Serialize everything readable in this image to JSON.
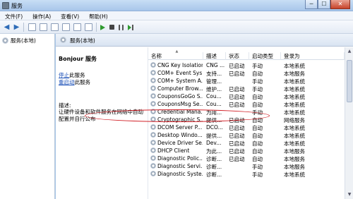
{
  "window": {
    "title": "服务",
    "min": "─",
    "max": "☐",
    "close": "✕"
  },
  "menu": [
    "文件(F)",
    "操作(A)",
    "查看(V)",
    "帮助(H)"
  ],
  "tree": {
    "root_label": "服务(本地)"
  },
  "pane": {
    "header_label": "服务(本地)",
    "service_name": "Bonjour 服务",
    "stop_link": "停止",
    "stop_suffix": "此服务",
    "restart_link": "重启动",
    "restart_suffix": "此服务",
    "desc_label": "描述:",
    "desc_text": "让硬件设备和软件服务在网络中自动配置并自行公布"
  },
  "columns": {
    "name": "名称",
    "desc": "描述",
    "status": "状态",
    "startup": "启动类型",
    "logon": "登录为"
  },
  "services": [
    {
      "name": "CNG Key Isolation",
      "desc": "CNG ...",
      "status": "已启动",
      "startup": "手动",
      "logon": "本地系统"
    },
    {
      "name": "COM+ Event Sys...",
      "desc": "支持...",
      "status": "已启动",
      "startup": "自动",
      "logon": "本地服务"
    },
    {
      "name": "COM+ System A...",
      "desc": "管理...",
      "status": "",
      "startup": "手动",
      "logon": "本地系统"
    },
    {
      "name": "Computer Brow...",
      "desc": "维护...",
      "status": "已启动",
      "startup": "手动",
      "logon": "本地系统"
    },
    {
      "name": "CouponsGoGo S...",
      "desc": "Cou...",
      "status": "已启动",
      "startup": "自动",
      "logon": "本地系统"
    },
    {
      "name": "CouponsMsg Se...",
      "desc": "Cou...",
      "status": "已启动",
      "startup": "自动",
      "logon": "本地系统"
    },
    {
      "name": "Credential Mana...",
      "desc": "为用...",
      "status": "",
      "startup": "手动",
      "logon": "本地系统"
    },
    {
      "name": "Cryptographic S...",
      "desc": "提供...",
      "status": "已启动",
      "startup": "自动",
      "logon": "网络服务"
    },
    {
      "name": "DCOM Server P...",
      "desc": "DCO...",
      "status": "已启动",
      "startup": "自动",
      "logon": "本地系统"
    },
    {
      "name": "Desktop Windo...",
      "desc": "提供...",
      "status": "已启动",
      "startup": "自动",
      "logon": "本地系统"
    },
    {
      "name": "Device Driver Se...",
      "desc": "Dev...",
      "status": "已启动",
      "startup": "自动",
      "logon": "本地系统"
    },
    {
      "name": "DHCP Client",
      "desc": "为此...",
      "status": "已启动",
      "startup": "自动",
      "logon": "本地服务"
    },
    {
      "name": "Diagnostic Polic...",
      "desc": "诊断...",
      "status": "已启动",
      "startup": "自动",
      "logon": "本地服务"
    },
    {
      "name": "Diagnostic Servi...",
      "desc": "诊断...",
      "status": "",
      "startup": "手动",
      "logon": "本地服务"
    },
    {
      "name": "Diagnostic Syste...",
      "desc": "诊断...",
      "status": "",
      "startup": "手动",
      "logon": "本地系统"
    }
  ],
  "colors": {
    "accent": "#2e6bb7",
    "highlight_ellipse": "#d2232a",
    "link": "#1a4fb7"
  }
}
